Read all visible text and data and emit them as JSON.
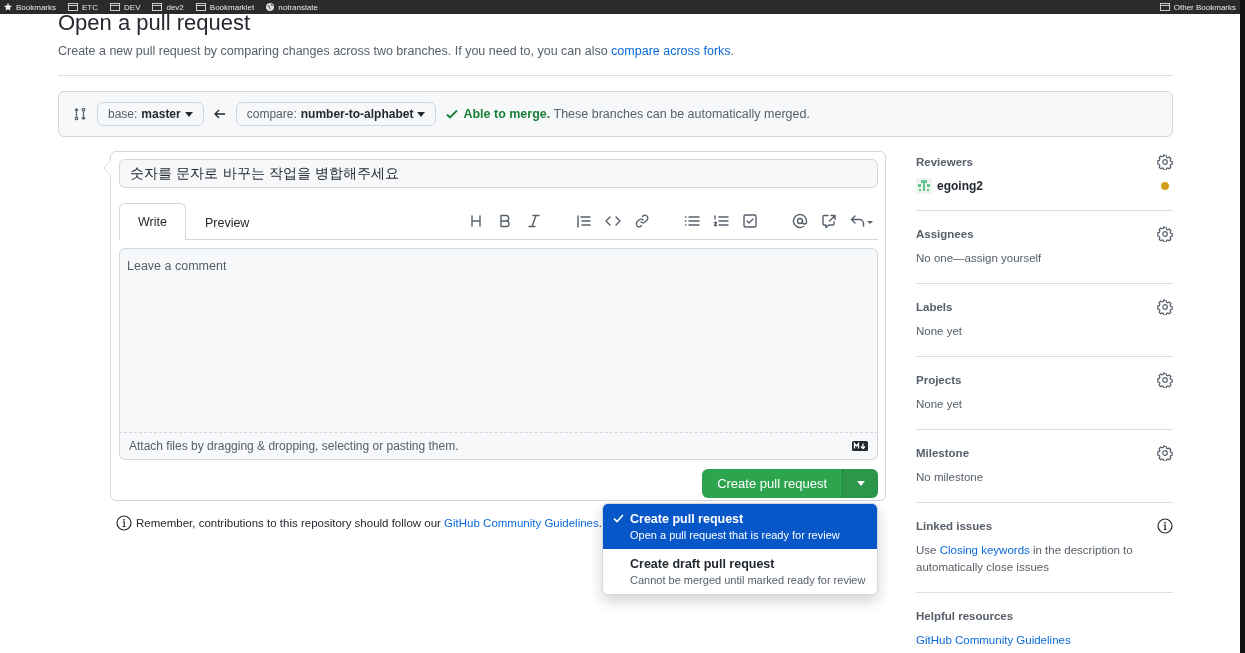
{
  "bookmarks": {
    "items": [
      {
        "label": "Bookmarks",
        "kind": "star"
      },
      {
        "label": "ETC",
        "kind": "folder"
      },
      {
        "label": "DEV",
        "kind": "folder"
      },
      {
        "label": "dev2",
        "kind": "folder"
      },
      {
        "label": "Bookmarklet",
        "kind": "folder"
      },
      {
        "label": "notranslate",
        "kind": "globe"
      }
    ],
    "other": "Other Bookmarks"
  },
  "header": {
    "title": "Open a pull request",
    "description": "Create a new pull request by comparing changes across two branches. If you need to, you can also ",
    "description_link": "compare across forks",
    "description_end": "."
  },
  "compare_bar": {
    "base_label": "base:",
    "base_branch": "master",
    "compare_label": "compare:",
    "compare_branch": "number-to-alphabet",
    "merge_status": "Able to merge.",
    "merge_note": "These branches can be automatically merged."
  },
  "form": {
    "title_value": "숫자를 문자로 바꾸는 작업을 병합해주세요",
    "tabs": [
      {
        "label": "Write",
        "selected": true
      },
      {
        "label": "Preview",
        "selected": false
      }
    ],
    "comment_placeholder": "Leave a comment",
    "attach_note": "Attach files by dragging & dropping, selecting or pasting them.",
    "submit_button": "Create pull request"
  },
  "dropdown": {
    "items": [
      {
        "title": "Create pull request",
        "description": "Open a pull request that is ready for review",
        "selected": true
      },
      {
        "title": "Create draft pull request",
        "description": "Cannot be merged until marked ready for review",
        "selected": false
      }
    ]
  },
  "notice": {
    "text": "Remember, contributions to this repository should follow our ",
    "link": "GitHub Community Guidelines",
    "end": "."
  },
  "sidebar": [
    {
      "heading": "Reviewers",
      "kind": "reviewer",
      "name": "egoing2",
      "color": "#d4a017"
    },
    {
      "heading": "Assignees",
      "kind": "text",
      "text": "No one—assign yourself"
    },
    {
      "heading": "Labels",
      "kind": "text",
      "text": "None yet"
    },
    {
      "heading": "Projects",
      "kind": "text",
      "text": "None yet"
    },
    {
      "heading": "Milestone",
      "kind": "text",
      "text": "No milestone"
    },
    {
      "heading": "Linked issues",
      "kind": "linked",
      "before": "Use ",
      "link": "Closing keywords",
      "after": " in the description to automatically close issues"
    },
    {
      "heading": "Helpful resources",
      "kind": "link",
      "link": "GitHub Community Guidelines"
    }
  ]
}
